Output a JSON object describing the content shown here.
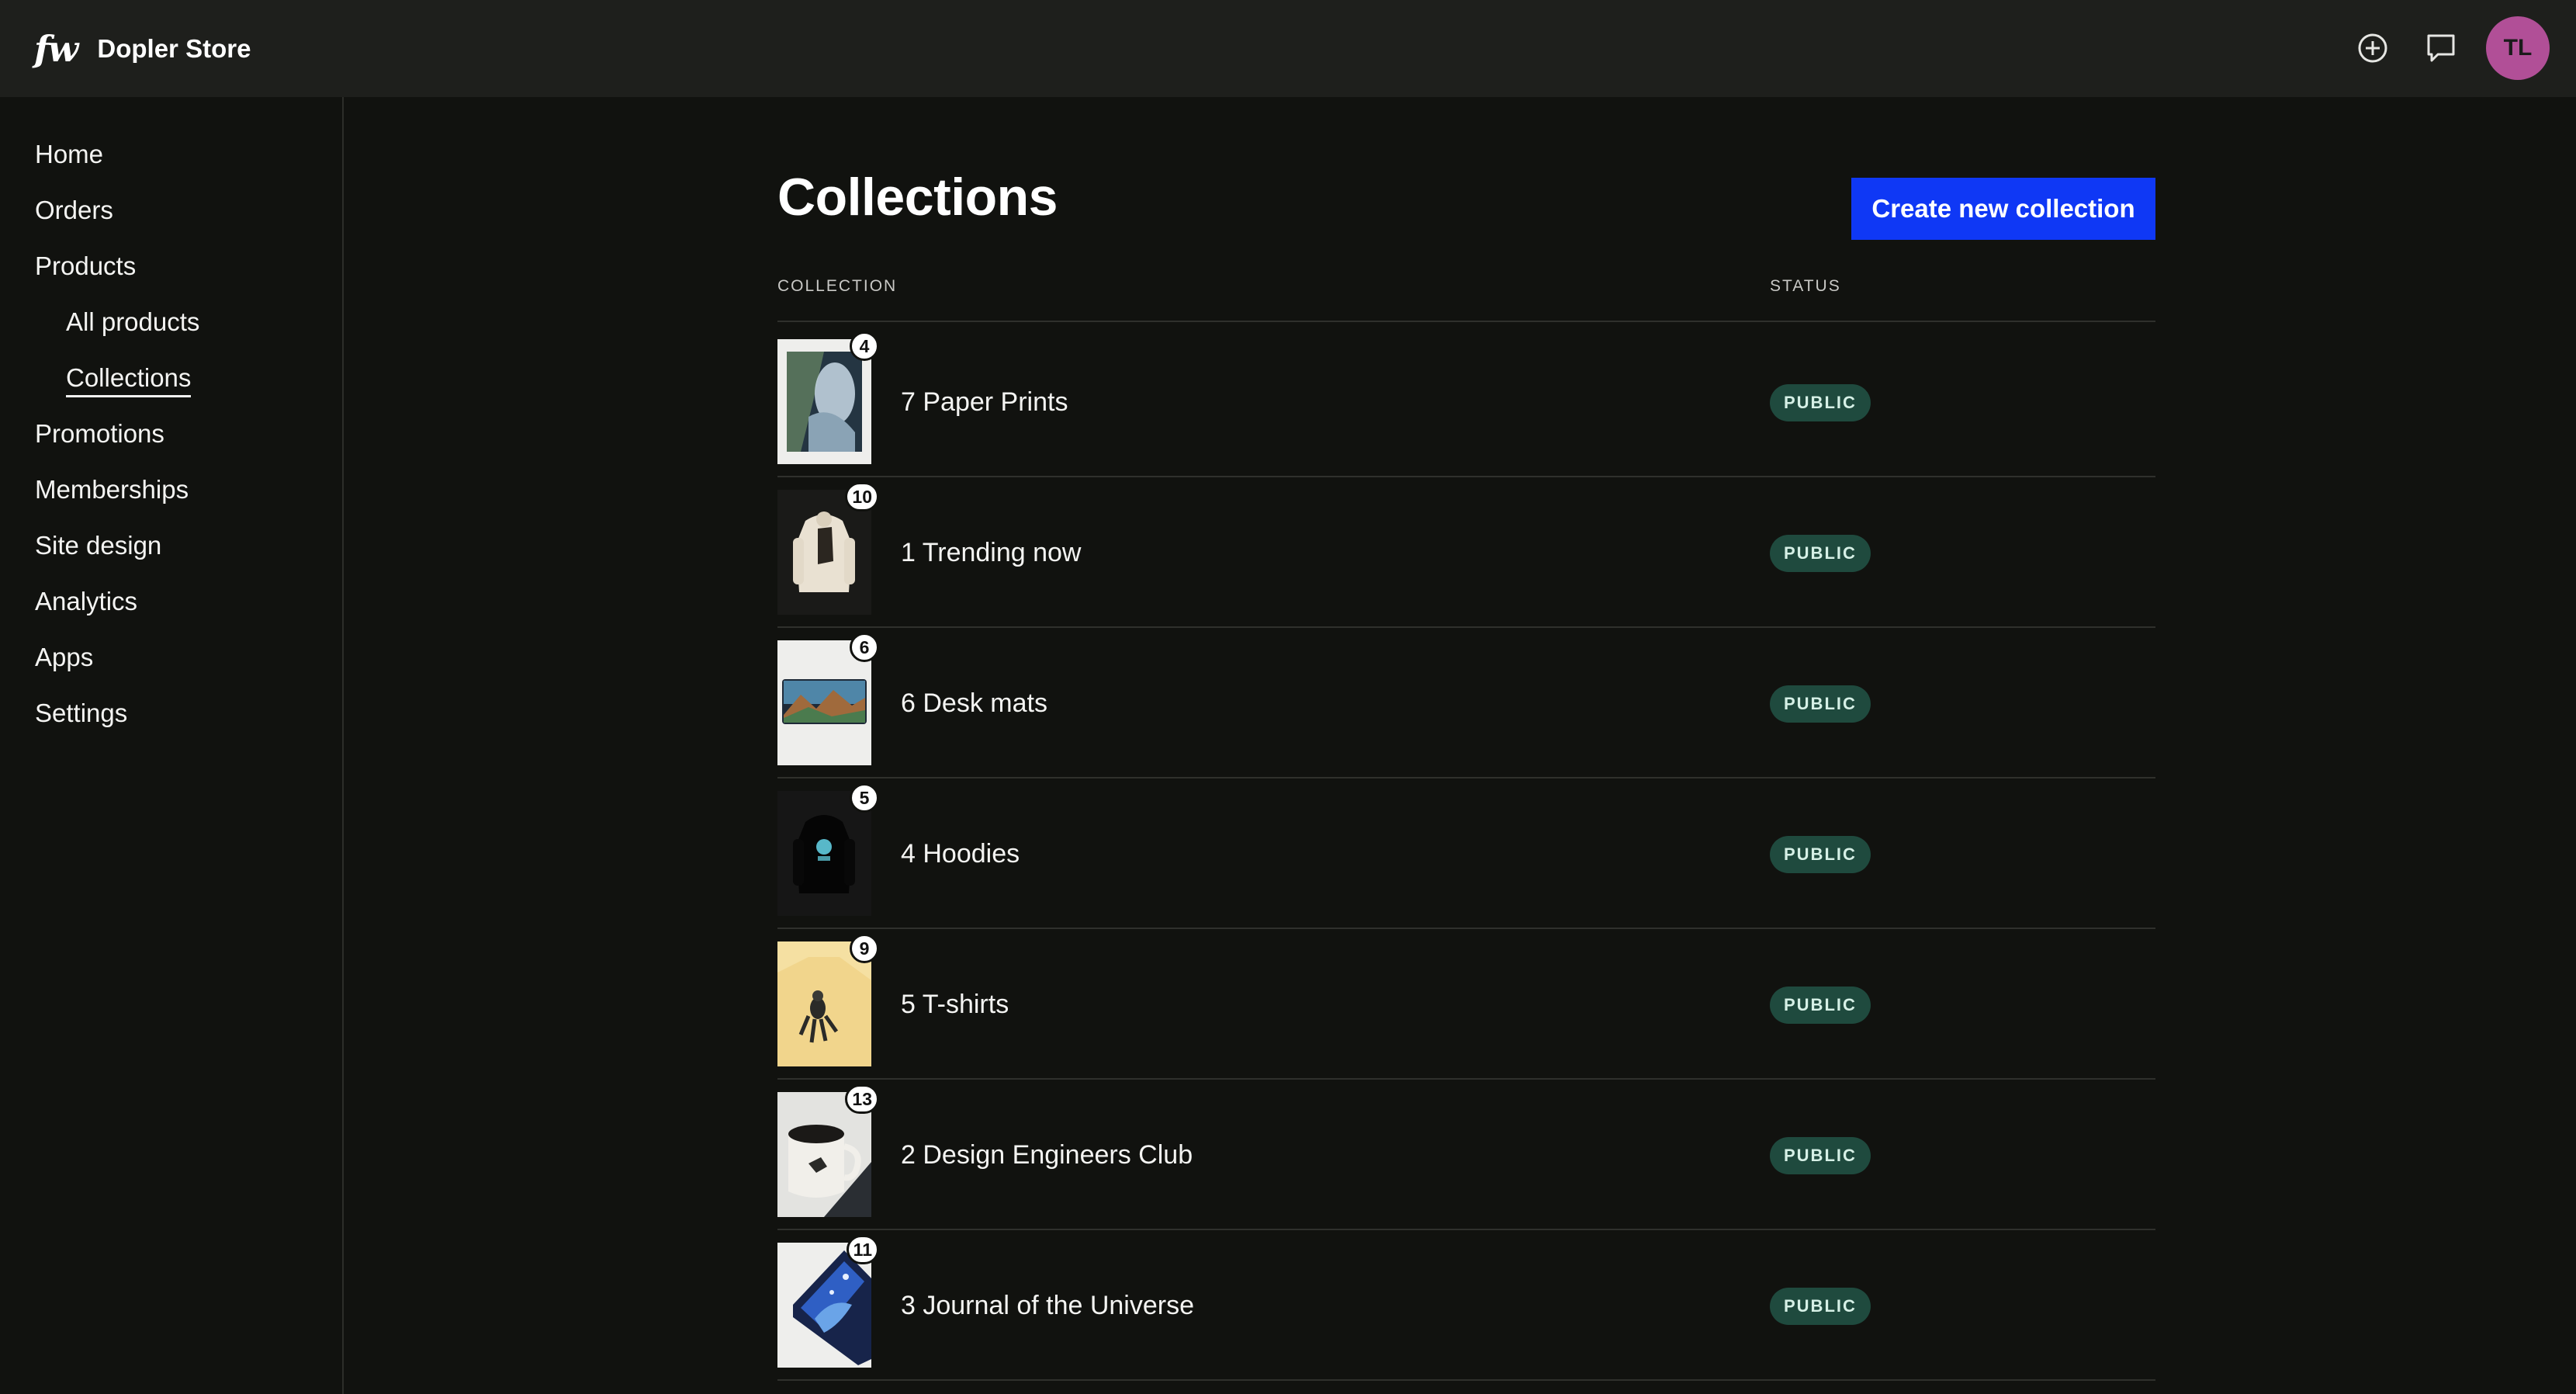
{
  "header": {
    "logo": "fw",
    "store_name": "Dopler Store",
    "avatar_initials": "TL"
  },
  "sidebar": {
    "items": [
      {
        "label": "Home"
      },
      {
        "label": "Orders"
      },
      {
        "label": "Products"
      },
      {
        "label": "All products"
      },
      {
        "label": "Collections"
      },
      {
        "label": "Promotions"
      },
      {
        "label": "Memberships"
      },
      {
        "label": "Site design"
      },
      {
        "label": "Analytics"
      },
      {
        "label": "Apps"
      },
      {
        "label": "Settings"
      }
    ]
  },
  "main": {
    "title": "Collections",
    "create_button": "Create new collection",
    "columns": {
      "collection": "COLLECTION",
      "status": "STATUS"
    },
    "rows": [
      {
        "name": "7 Paper Prints",
        "count": "4",
        "status": "PUBLIC"
      },
      {
        "name": "1 Trending now",
        "count": "10",
        "status": "PUBLIC"
      },
      {
        "name": "6 Desk mats",
        "count": "6",
        "status": "PUBLIC"
      },
      {
        "name": "4 Hoodies",
        "count": "5",
        "status": "PUBLIC"
      },
      {
        "name": "5 T-shirts",
        "count": "9",
        "status": "PUBLIC"
      },
      {
        "name": "2 Design Engineers Club",
        "count": "13",
        "status": "PUBLIC"
      },
      {
        "name": "3 Journal of the Universe",
        "count": "11",
        "status": "PUBLIC"
      }
    ]
  },
  "colors": {
    "accent": "#0f38f5",
    "status_bg": "#1f4a3e",
    "avatar": "#b14f97"
  }
}
